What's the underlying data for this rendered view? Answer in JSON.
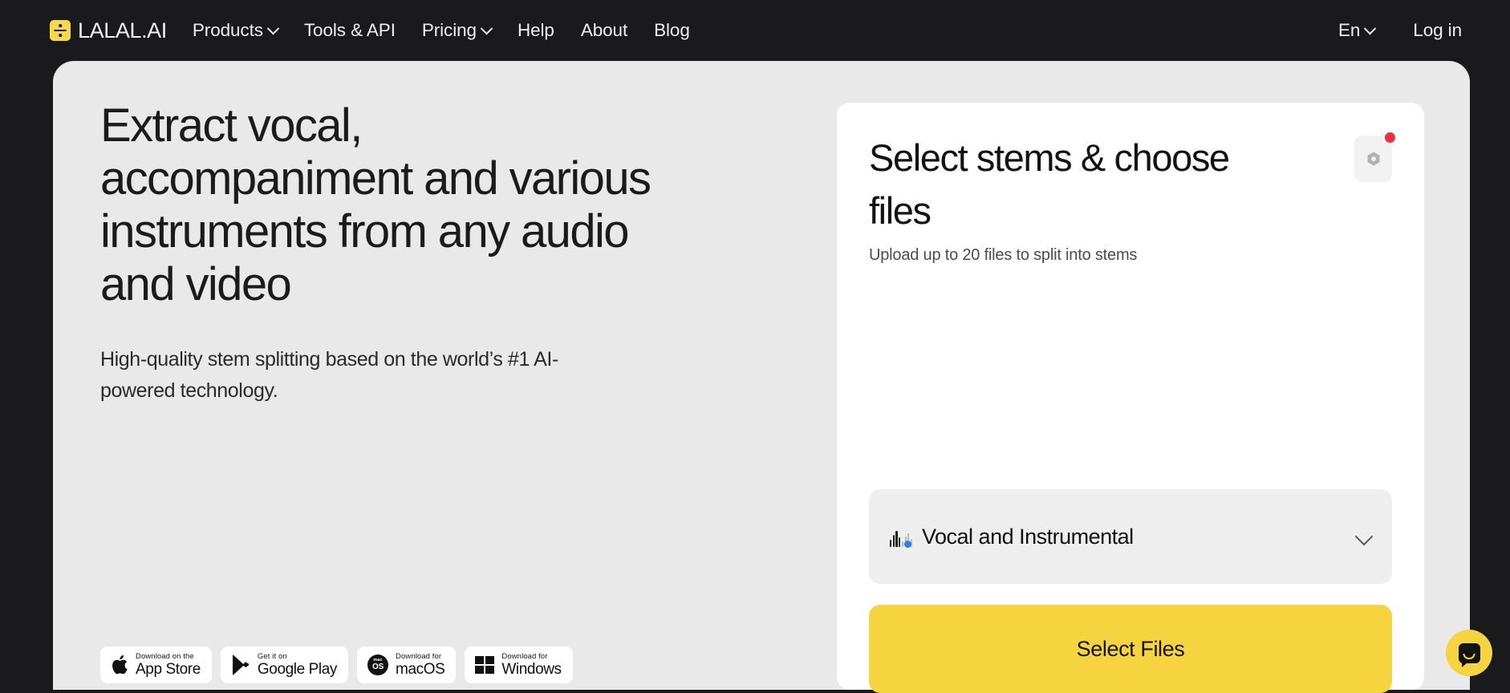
{
  "brand": {
    "name": "LALAL.AI",
    "logo_icon": "division-logo-icon",
    "logo_color": "#f5d949"
  },
  "nav": {
    "items": [
      {
        "label": "Products",
        "has_chevron": true
      },
      {
        "label": "Tools & API",
        "has_chevron": false
      },
      {
        "label": "Pricing",
        "has_chevron": true
      },
      {
        "label": "Help",
        "has_chevron": false
      },
      {
        "label": "About",
        "has_chevron": false
      },
      {
        "label": "Blog",
        "has_chevron": false
      }
    ],
    "language": "En",
    "login": "Log in"
  },
  "hero": {
    "title": "Extract vocal, accompaniment and various instruments from any audio and video",
    "subtitle": "High-quality stem splitting based on the world’s #1 AI-powered technology.",
    "background": "#e9e9e9"
  },
  "store_badges": [
    {
      "small": "Download on the",
      "big": "App Store",
      "icon": "apple-icon"
    },
    {
      "small": "Get it on",
      "big": "Google Play",
      "icon": "google-play-icon"
    },
    {
      "small": "Download for",
      "big": "macOS",
      "icon": "macos-icon"
    },
    {
      "small": "Download for",
      "big": "Windows",
      "icon": "windows-icon"
    }
  ],
  "upload": {
    "title": "Select stems & choose files",
    "subtitle": "Upload up to 20 files to split into stems",
    "settings_icon": "gear-nut-icon",
    "settings_badge_color": "#f02f3f",
    "stem_selector": {
      "value": "Vocal and Instrumental",
      "icon": "waveform-icon",
      "chevron": "chevron-down-icon"
    },
    "select_files_label": "Select Files",
    "accent_color": "#f5d43f"
  },
  "chat_widget": {
    "icon": "chat-bubble-icon",
    "color": "#f5d43f"
  }
}
